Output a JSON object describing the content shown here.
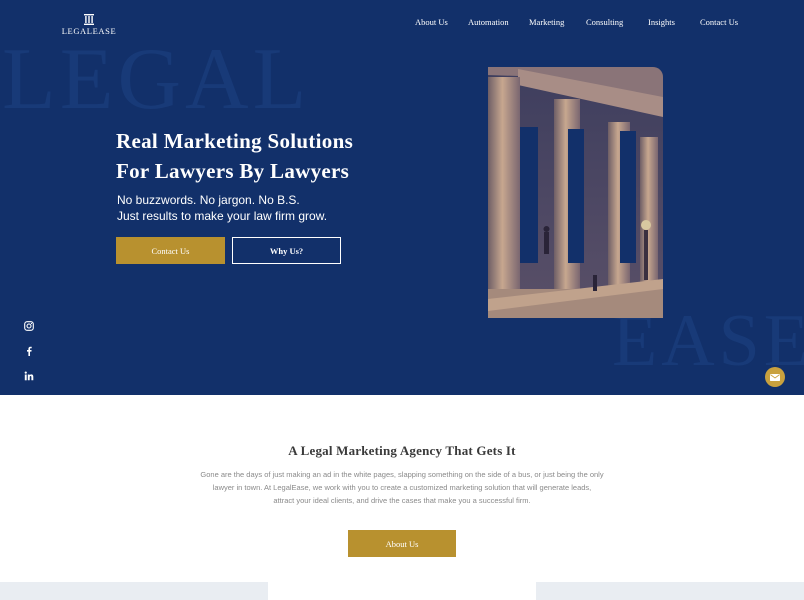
{
  "brand": {
    "name": "LEGALEASE",
    "icon": "column-logo-icon"
  },
  "nav": [
    {
      "label": "About Us"
    },
    {
      "label": "Automation"
    },
    {
      "label": "Marketing"
    },
    {
      "label": "Consulting"
    },
    {
      "label": "Insights"
    },
    {
      "label": "Contact Us"
    }
  ],
  "hero": {
    "watermark_top": "LEGAL",
    "watermark_bottom": "EASE",
    "headline_line1": "Real Marketing Solutions",
    "headline_line2": "For Lawyers By Lawyers",
    "sub_line1": "No buzzwords. No jargon. No B.S.",
    "sub_line2": "Just results to make your law firm grow.",
    "primary_button": "Contact Us",
    "secondary_button": "Why Us?"
  },
  "social": [
    "instagram-icon",
    "facebook-icon",
    "linkedin-icon"
  ],
  "chat": {
    "icon": "mail-icon"
  },
  "section": {
    "title": "A Legal Marketing Agency That Gets It",
    "body_line1": "Gone are the days of just making an ad in the white pages, slapping something on  the side of a bus, or just being the only",
    "body_line2": "lawyer in town. At LegalEase, we work with you to create a customized marketing solution that will generate leads,",
    "body_line3": "attract your ideal clients, and drive the cases that make you a successful firm.",
    "button": "About Us"
  },
  "colors": {
    "navy": "#12306a",
    "gold": "#b8912f",
    "white": "#ffffff",
    "text_gray": "#8a8a8a"
  }
}
